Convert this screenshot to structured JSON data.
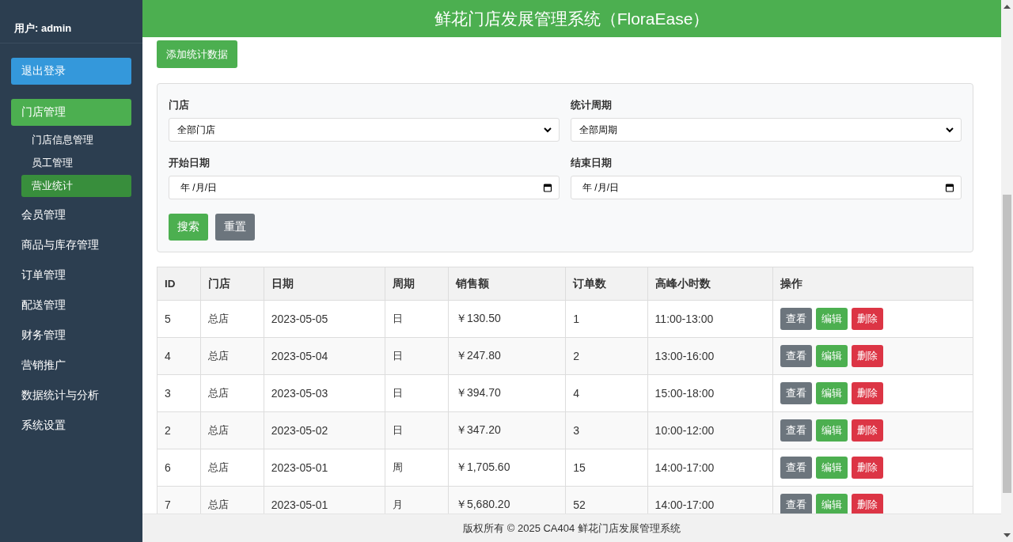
{
  "sidebar": {
    "user": "用户: admin",
    "logout": "退出登录",
    "items": [
      {
        "label": "门店管理",
        "selected": true,
        "children": [
          {
            "label": "门店信息管理",
            "selected": false
          },
          {
            "label": "员工管理",
            "selected": false
          },
          {
            "label": "营业统计",
            "selected": true
          }
        ]
      },
      {
        "label": "会员管理",
        "selected": false
      },
      {
        "label": "商品与库存管理",
        "selected": false
      },
      {
        "label": "订单管理",
        "selected": false
      },
      {
        "label": "配送管理",
        "selected": false
      },
      {
        "label": "财务管理",
        "selected": false
      },
      {
        "label": "营销推广",
        "selected": false
      },
      {
        "label": "数据统计与分析",
        "selected": false
      },
      {
        "label": "系统设置",
        "selected": false
      }
    ]
  },
  "header": {
    "title": "鲜花门店发展管理系统（FloraEase）"
  },
  "add_button": "添加统计数据",
  "filters": {
    "fields": [
      {
        "kind": "select",
        "label": "门店",
        "value": "全部门店"
      },
      {
        "kind": "select",
        "label": "统计周期",
        "value": "全部周期"
      },
      {
        "kind": "date",
        "label": "开始日期",
        "placeholder": "年 /月/日"
      },
      {
        "kind": "date",
        "label": "结束日期",
        "placeholder": "年 /月/日"
      }
    ],
    "buttons": [
      {
        "kind": "primary",
        "label": "搜索"
      },
      {
        "kind": "secondary",
        "label": "重置"
      }
    ]
  },
  "table": {
    "columns": [
      "ID",
      "门店",
      "日期",
      "周期",
      "销售额",
      "订单数",
      "高峰小时数",
      "操作"
    ],
    "rows": [
      {
        "cells": [
          "5",
          "总店",
          "2023-05-05",
          "日",
          "￥130.50",
          "1",
          "11:00-13:00"
        ],
        "actions": [
          {
            "kind": "view",
            "label": "查看"
          },
          {
            "kind": "edit",
            "label": "编辑"
          },
          {
            "kind": "delete",
            "label": "删除"
          }
        ]
      },
      {
        "cells": [
          "4",
          "总店",
          "2023-05-04",
          "日",
          "￥247.80",
          "2",
          "13:00-16:00"
        ],
        "actions": [
          {
            "kind": "view",
            "label": "查看"
          },
          {
            "kind": "edit",
            "label": "编辑"
          },
          {
            "kind": "delete",
            "label": "删除"
          }
        ]
      },
      {
        "cells": [
          "3",
          "总店",
          "2023-05-03",
          "日",
          "￥394.70",
          "4",
          "15:00-18:00"
        ],
        "actions": [
          {
            "kind": "view",
            "label": "查看"
          },
          {
            "kind": "edit",
            "label": "编辑"
          },
          {
            "kind": "delete",
            "label": "删除"
          }
        ]
      },
      {
        "cells": [
          "2",
          "总店",
          "2023-05-02",
          "日",
          "￥347.20",
          "3",
          "10:00-12:00"
        ],
        "actions": [
          {
            "kind": "view",
            "label": "查看"
          },
          {
            "kind": "edit",
            "label": "编辑"
          },
          {
            "kind": "delete",
            "label": "删除"
          }
        ]
      },
      {
        "cells": [
          "6",
          "总店",
          "2023-05-01",
          "周",
          "￥1,705.60",
          "15",
          "14:00-17:00"
        ],
        "actions": [
          {
            "kind": "view",
            "label": "查看"
          },
          {
            "kind": "edit",
            "label": "编辑"
          },
          {
            "kind": "delete",
            "label": "删除"
          }
        ]
      },
      {
        "cells": [
          "7",
          "总店",
          "2023-05-01",
          "月",
          "￥5,680.20",
          "52",
          "14:00-17:00"
        ],
        "actions": [
          {
            "kind": "view",
            "label": "查看"
          },
          {
            "kind": "edit",
            "label": "编辑"
          },
          {
            "kind": "delete",
            "label": "删除"
          }
        ]
      }
    ]
  },
  "footer": "版权所有 © 2025 CA404 鲜花门店发展管理系统"
}
